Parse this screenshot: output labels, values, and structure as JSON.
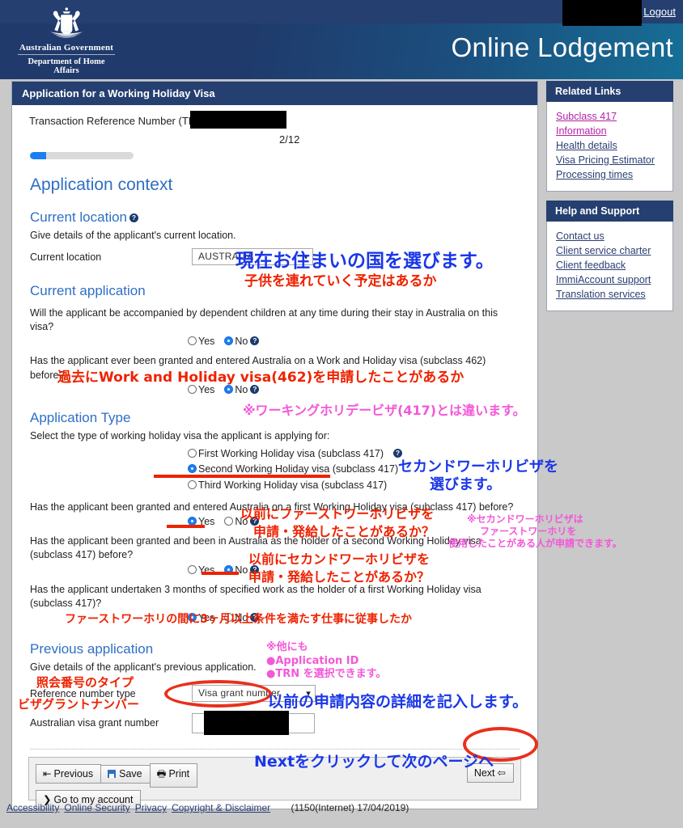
{
  "header": {
    "logout_label": "Logout",
    "crest_line1": "Australian Government",
    "crest_line2": "Department of Home Affairs",
    "app_title": "Online Lodgement"
  },
  "form": {
    "title": "Application for a Working Holiday Visa",
    "trn_label": "Transaction Reference Number (TRN):",
    "page_count": "2/12",
    "section_application_context": "Application context",
    "current_location": {
      "heading": "Current location",
      "description": "Give details of the applicant's current location.",
      "field_label": "Current location",
      "value": "AUSTRALIA"
    },
    "current_application": {
      "heading": "Current application",
      "q1": "Will the applicant be accompanied by dependent children at any time during their stay in Australia on this visa?",
      "q1_yes": "Yes",
      "q1_no": "No",
      "q1_selected": "No",
      "q2": "Has the applicant ever been granted and entered Australia on a Work and Holiday visa (subclass 462) before?",
      "q2_yes": "Yes",
      "q2_no": "No",
      "q2_selected": "No"
    },
    "application_type": {
      "heading": "Application Type",
      "prompt": "Select the type of working holiday visa the applicant is applying for:",
      "options": [
        "First Working Holiday visa (subclass 417)",
        "Second Working Holiday visa (subclass 417)",
        "Third Working Holiday visa (subclass 417)"
      ],
      "selected_option": "Second Working Holiday visa (subclass 417)",
      "q3": "Has the applicant been granted and entered Australia on a first Working Holiday visa (subclass 417) before?",
      "q3_yes": "Yes",
      "q3_no": "No",
      "q3_selected": "Yes",
      "q4": "Has the applicant been granted and been in Australia as the holder of a second Working Holiday visa (subclass 417) before?",
      "q4_yes": "Yes",
      "q4_no": "No",
      "q4_selected": "No",
      "q5": "Has the applicant undertaken 3 months of specified work as the holder of a first Working Holiday visa (subclass 417)?",
      "q5_yes": "Yes",
      "q5_no": "No",
      "q5_selected": "Yes"
    },
    "previous_application": {
      "heading": "Previous application",
      "description": "Give details of the applicant's previous application.",
      "ref_type_label": "Reference number type",
      "ref_type_value": "Visa grant number",
      "grant_number_label": "Australian visa grant number",
      "grant_number_value": ""
    },
    "buttons": {
      "previous": "Previous",
      "save": "Save",
      "print": "Print",
      "go_to_my_account": "Go to my account",
      "next": "Next"
    }
  },
  "sidebar": {
    "related_links": {
      "title": "Related Links",
      "items": [
        "Subclass 417",
        "Information",
        "Health details",
        "Visa Pricing Estimator",
        "Processing times"
      ]
    },
    "help_and_support": {
      "title": "Help and Support",
      "items": [
        "Contact us",
        "Client service charter",
        "Client feedback",
        "ImmiAccount support",
        "Translation services"
      ]
    }
  },
  "footer": {
    "links": [
      "Accessibility",
      "Online Security",
      "Privacy",
      "Copyright & Disclaimer"
    ],
    "version": "(1150(Internet) 17/04/2019)"
  },
  "annotations": {
    "a1": "現在お住まいの国を選びます。",
    "a2": "子供を連れていく予定はあるか",
    "a3": "過去にWork and Holiday visa(462)を申請したことがあるか",
    "a4": "※ワーキングホリデービザ(417)とは違います。",
    "a5_line1": "セカンドワーホリビザを",
    "a5_line2": "選びます。",
    "a6_line1": "以前にファーストワーホリビザを",
    "a6_line2": "申請・発給したことがあるか？",
    "a7_line1": "※セカンドワーホリビザは",
    "a7_line2": "ファーストワーホリを",
    "a7_line3": "使用したことがある人が申請できます。",
    "a8_line1": "以前にセカンドワーホリビザを",
    "a8_line2": "申請・発給したことがあるか？",
    "a9": "ファーストワーホリの間に3ヶ月以上条件を満たす仕事に従事したか",
    "a10_line1": "※他にも",
    "a10_line2": "●Application ID",
    "a10_line3": "●TRN を選択できます。",
    "a11": "照会番号のタイプ",
    "a12": "ビザグラントナンバー",
    "a13": "以前の申請内容の詳細を記入します。",
    "a14": "Nextをクリックして次のページへ"
  },
  "colors": {
    "brand_navy": "#253f70",
    "accent_blue": "#2f6fc4",
    "progress": "#1a7ef4",
    "annotation_blue": "#1a37e8",
    "annotation_red": "#ee2200",
    "annotation_pink": "#f457d8",
    "circle_red": "#e8301c"
  }
}
